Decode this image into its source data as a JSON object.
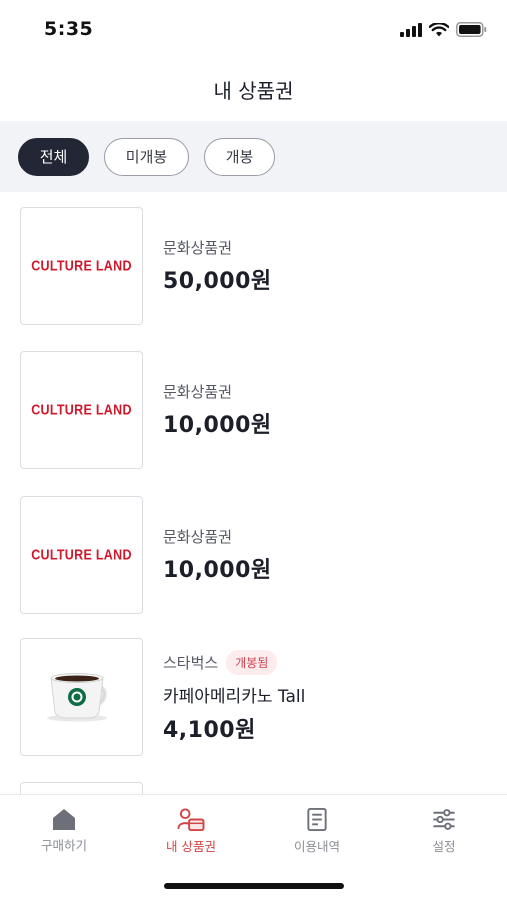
{
  "status_bar": {
    "time": "5:35"
  },
  "header": {
    "title": "내 상품권"
  },
  "filters": [
    {
      "label": "전체",
      "active": true
    },
    {
      "label": "미개봉",
      "active": false
    },
    {
      "label": "개봉",
      "active": false
    }
  ],
  "items": [
    {
      "logo": "CULTURE LAND",
      "brand": "문화상품권",
      "badge": "",
      "product": "",
      "price": "50,000원"
    },
    {
      "logo": "CULTURE LAND",
      "brand": "문화상품권",
      "badge": "",
      "product": "",
      "price": "10,000원"
    },
    {
      "logo": "CULTURE LAND",
      "brand": "문화상품권",
      "badge": "",
      "product": "",
      "price": "10,000원"
    },
    {
      "logo": "",
      "brand": "스타벅스",
      "badge": "개봉됨",
      "product": "카페아메리카노 Tall",
      "price": "4,100원"
    }
  ],
  "tabs": [
    {
      "label": "구매하기",
      "icon": "home-icon"
    },
    {
      "label": "내 상품권",
      "icon": "my-voucher-icon",
      "active": true
    },
    {
      "label": "이용내역",
      "icon": "document-icon"
    },
    {
      "label": "설정",
      "icon": "settings-sliders-icon"
    }
  ],
  "colors": {
    "accent": "#d04545",
    "logo_red": "#d0182b",
    "chip_active": "#232735",
    "filter_bg": "#f2f3f7"
  }
}
